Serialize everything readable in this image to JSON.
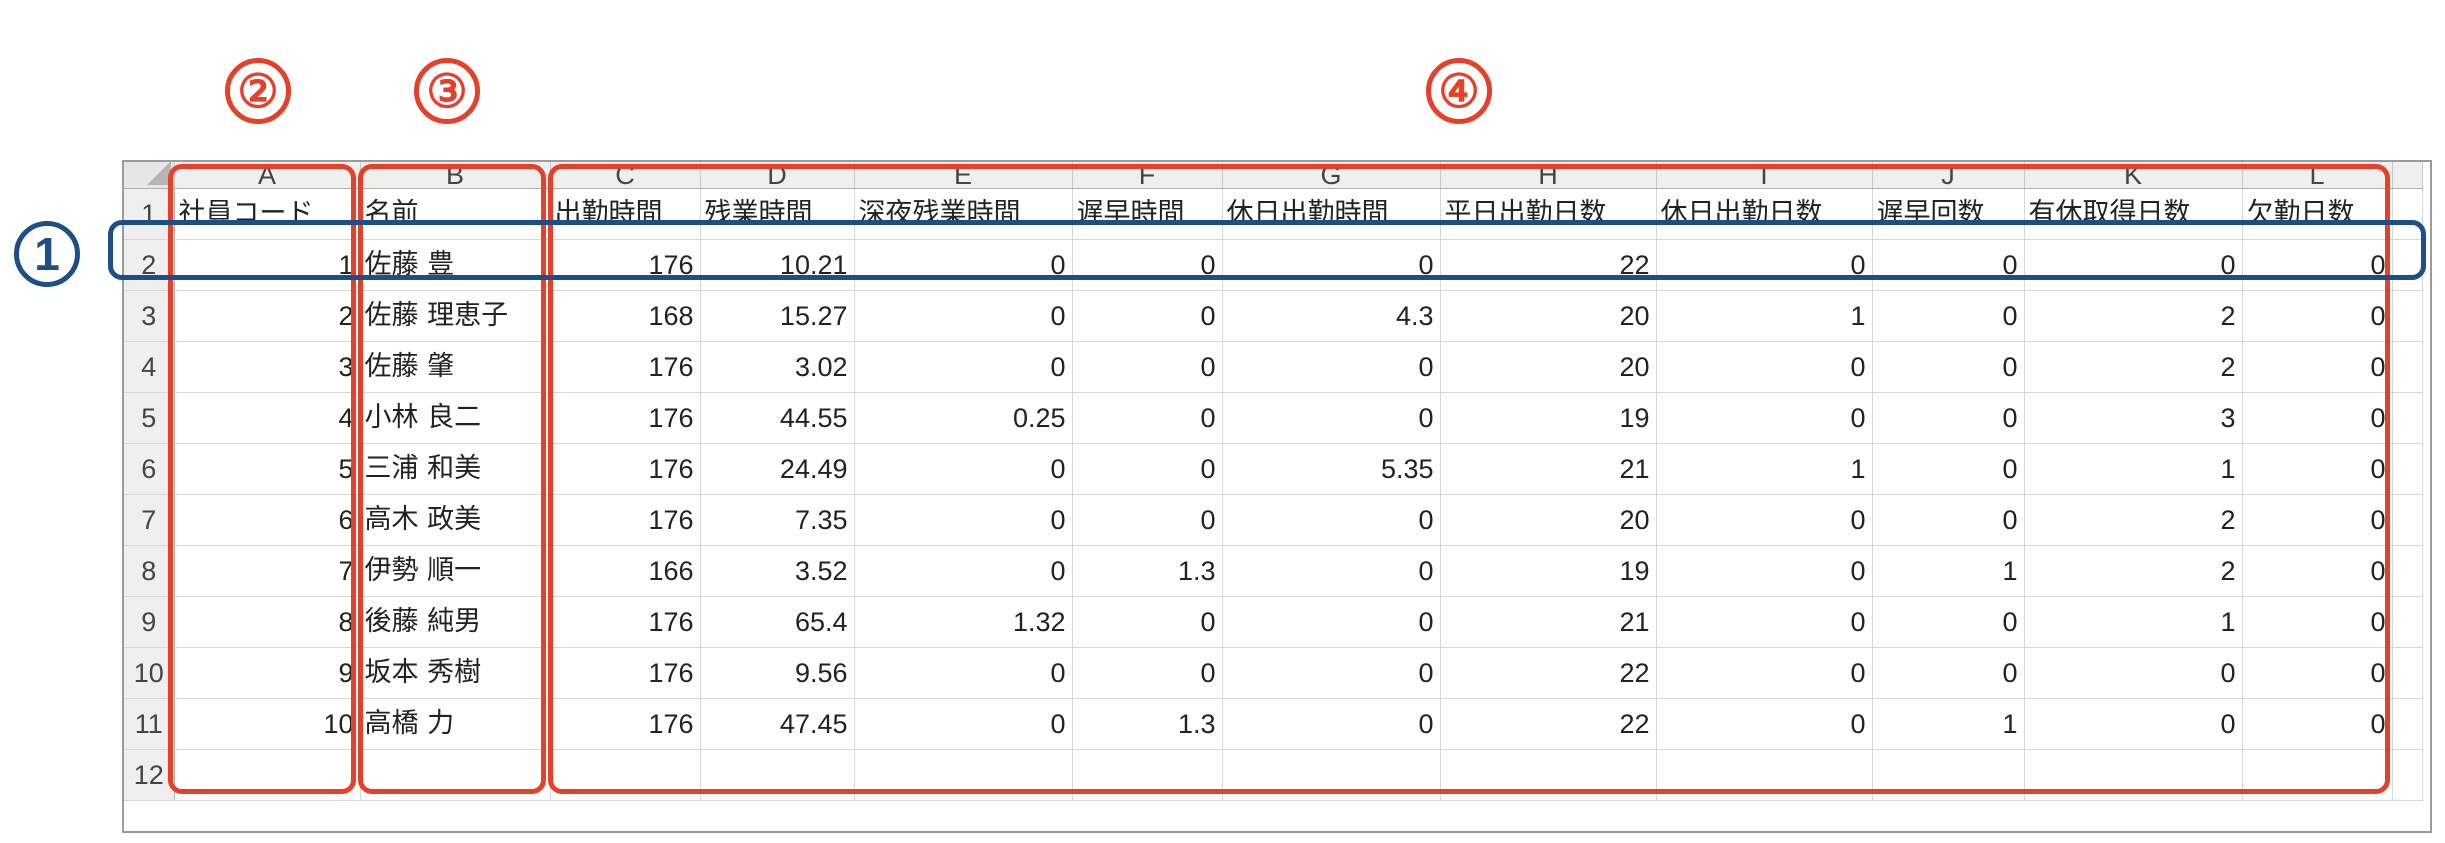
{
  "columns": [
    "A",
    "B",
    "C",
    "D",
    "E",
    "F",
    "G",
    "H",
    "I",
    "J",
    "K",
    "L"
  ],
  "header_row": {
    "row_num": "1",
    "cells": [
      "社員コード",
      "名前",
      "出勤時間",
      "残業時間",
      "深夜残業時間",
      "遅早時間",
      "休日出勤時間",
      "平日出勤日数",
      "休日出勤日数",
      "遅早回数",
      "有休取得日数",
      "欠勤日数"
    ]
  },
  "rows": [
    {
      "row_num": "2",
      "cells": [
        "1",
        "佐藤 豊",
        "176",
        "10.21",
        "0",
        "0",
        "0",
        "22",
        "0",
        "0",
        "0",
        "0"
      ]
    },
    {
      "row_num": "3",
      "cells": [
        "2",
        "佐藤 理恵子",
        "168",
        "15.27",
        "0",
        "0",
        "4.3",
        "20",
        "1",
        "0",
        "2",
        "0"
      ]
    },
    {
      "row_num": "4",
      "cells": [
        "3",
        "佐藤 肇",
        "176",
        "3.02",
        "0",
        "0",
        "0",
        "20",
        "0",
        "0",
        "2",
        "0"
      ]
    },
    {
      "row_num": "5",
      "cells": [
        "4",
        "小林 良二",
        "176",
        "44.55",
        "0.25",
        "0",
        "0",
        "19",
        "0",
        "0",
        "3",
        "0"
      ]
    },
    {
      "row_num": "6",
      "cells": [
        "5",
        "三浦 和美",
        "176",
        "24.49",
        "0",
        "0",
        "5.35",
        "21",
        "1",
        "0",
        "1",
        "0"
      ]
    },
    {
      "row_num": "7",
      "cells": [
        "6",
        "高木 政美",
        "176",
        "7.35",
        "0",
        "0",
        "0",
        "20",
        "0",
        "0",
        "2",
        "0"
      ]
    },
    {
      "row_num": "8",
      "cells": [
        "7",
        "伊勢 順一",
        "166",
        "3.52",
        "0",
        "1.3",
        "0",
        "19",
        "0",
        "1",
        "2",
        "0"
      ]
    },
    {
      "row_num": "9",
      "cells": [
        "8",
        "後藤 純男",
        "176",
        "65.4",
        "1.32",
        "0",
        "0",
        "21",
        "0",
        "0",
        "1",
        "0"
      ]
    },
    {
      "row_num": "10",
      "cells": [
        "9",
        "坂本 秀樹",
        "176",
        "9.56",
        "0",
        "0",
        "0",
        "22",
        "0",
        "0",
        "0",
        "0"
      ]
    },
    {
      "row_num": "11",
      "cells": [
        "10",
        "高橋 力",
        "176",
        "47.45",
        "0",
        "1.3",
        "0",
        "22",
        "0",
        "1",
        "0",
        "0"
      ]
    }
  ],
  "empty_row": {
    "row_num": "12"
  },
  "annotations": {
    "marker_1": "1",
    "marker_2": "②",
    "marker_3": "③",
    "marker_4": "④",
    "red_color": "#e4402a",
    "blue_color": "#1d4f86"
  }
}
